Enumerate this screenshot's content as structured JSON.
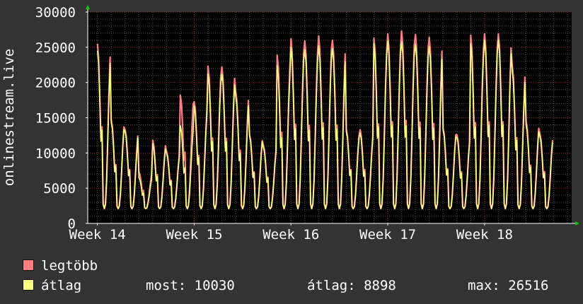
{
  "chart_data": {
    "type": "area",
    "ylabel": "onlinestream.live",
    "ylim": [
      0,
      30000
    ],
    "y_ticks": [
      0,
      5000,
      10000,
      15000,
      20000,
      25000,
      30000
    ],
    "x_ticks": [
      "Week 14",
      "Week 15",
      "Week 16",
      "Week 17",
      "Week 18"
    ],
    "x_range_weeks": [
      13.9,
      18.9
    ],
    "grid": true,
    "series": [
      {
        "name": "legtöbb",
        "color": "#ff7f7f",
        "daily_peaks": [
          25500,
          14700,
          13300,
          7300,
          11800,
          10200,
          18200,
          17300,
          22300,
          22200,
          18800,
          12600,
          11100,
          23900,
          26200,
          25900,
          26600,
          26000,
          13300,
          13300,
          26300,
          26900,
          27300,
          26800,
          26400,
          13500,
          12600,
          26700,
          26900,
          26900,
          22400,
          14500,
          12700
        ]
      },
      {
        "name": "átlag",
        "color": "#ffff80",
        "daily_peaks": [
          24500,
          14300,
          13000,
          6500,
          11300,
          9900,
          13900,
          16700,
          21200,
          21200,
          18000,
          12400,
          10800,
          22400,
          25000,
          24600,
          25200,
          24800,
          13000,
          12800,
          25500,
          25900,
          25800,
          25400,
          25100,
          13200,
          12200,
          25500,
          26000,
          26000,
          21600,
          14000,
          12300
        ]
      }
    ],
    "stats": {
      "now": 10030,
      "avg": 8898,
      "max": 26516
    }
  },
  "legend": {
    "max_label": "legtöbb",
    "avg_label": "átlag",
    "now_text": "most: 10030",
    "avg_text": "átlag: 8898",
    "max_text": "max: 26516"
  },
  "colors": {
    "background": "#333333",
    "plot_background": "#000000",
    "grid_minor": "#505050",
    "grid_major": "#a03030",
    "axis": "#ffffff",
    "arrow": "#00cc00"
  }
}
